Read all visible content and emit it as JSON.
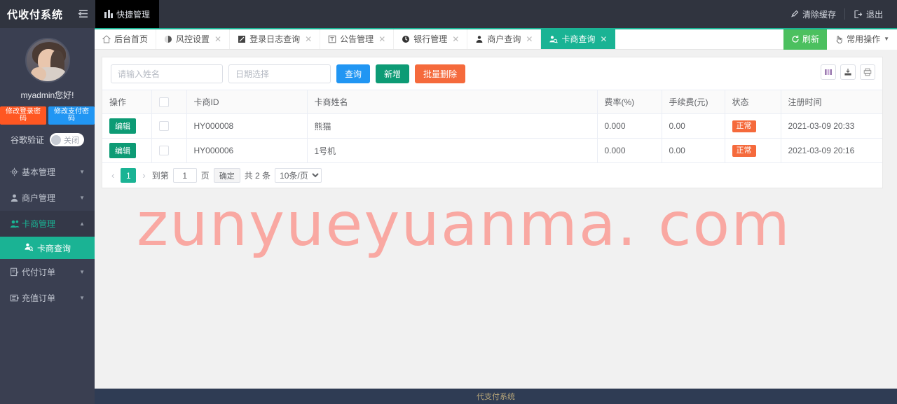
{
  "header": {
    "brand": "代收付系统",
    "collapse_icon": "collapse-menu-icon",
    "quick_tab": "快捷管理",
    "clear_cache": "清除缓存",
    "logout": "退出"
  },
  "sidebar": {
    "greeting": "myadmin您好!",
    "btn_change_login_pw": "修改登录密码",
    "btn_change_pay_pw": "修改支付密码",
    "ga_label": "谷歌验证",
    "ga_state": "关闭",
    "menu": [
      {
        "label": "基本管理",
        "icon": "gear-icon",
        "expanded": false
      },
      {
        "label": "商户管理",
        "icon": "user-icon",
        "expanded": false
      },
      {
        "label": "卡商管理",
        "icon": "users-icon",
        "expanded": true
      },
      {
        "label": "代付订单",
        "icon": "file-edit-icon",
        "expanded": false
      },
      {
        "label": "充值订单",
        "icon": "wallet-icon",
        "expanded": false
      }
    ],
    "submenu": {
      "label": "卡商查询",
      "icon": "user-search-icon",
      "active": true
    }
  },
  "tabbar": {
    "tabs": [
      {
        "label": "后台首页",
        "icon": "home-icon",
        "closable": false,
        "active": false
      },
      {
        "label": "风控设置",
        "icon": "shield-icon",
        "closable": true,
        "active": false
      },
      {
        "label": "登录日志查询",
        "icon": "log-icon",
        "closable": true,
        "active": false
      },
      {
        "label": "公告管理",
        "icon": "announce-icon",
        "closable": true,
        "active": false
      },
      {
        "label": "银行管理",
        "icon": "bank-icon",
        "closable": true,
        "active": false
      },
      {
        "label": "商户查询",
        "icon": "person-icon",
        "closable": true,
        "active": false
      },
      {
        "label": "卡商查询",
        "icon": "person-search-icon",
        "closable": true,
        "active": true
      }
    ],
    "refresh": "刷新",
    "common_ops": "常用操作"
  },
  "toolbar": {
    "name_placeholder": "请输入姓名",
    "name_value": "",
    "date_placeholder": "日期选择",
    "date_value": "",
    "btn_query": "查询",
    "btn_add": "新增",
    "btn_batch_delete": "批量删除",
    "icons": [
      "columns-icon",
      "export-icon",
      "print-icon"
    ]
  },
  "table": {
    "columns": [
      "操作",
      "",
      "卡商ID",
      "卡商姓名",
      "费率(%)",
      "手续费(元)",
      "状态",
      "注册时间"
    ],
    "edit_label": "编辑",
    "rows": [
      {
        "id": "HY000008",
        "name": "熊猫",
        "rate": "0.000",
        "fee": "0.00",
        "status": "正常",
        "time": "2021-03-09 20:33"
      },
      {
        "id": "HY000006",
        "name": "1号机",
        "rate": "0.000",
        "fee": "0.00",
        "status": "正常",
        "time": "2021-03-09 20:16"
      }
    ]
  },
  "pager": {
    "prev": "‹",
    "current": "1",
    "next": "›",
    "goto_label": "到第",
    "goto_value": "1",
    "page_unit": "页",
    "confirm": "确定",
    "total": "共 2 条",
    "page_size": "10条/页"
  },
  "watermark": "zunyueyuanma. com",
  "footer": {
    "text": "代支付系统"
  },
  "colors": {
    "teal": "#1ab394",
    "green": "#4cc05f",
    "blue": "#2196f3",
    "orange": "#f56a3c",
    "dark": "#3a3f51",
    "header": "#30343f",
    "footer": "#2f3c54",
    "watermark": "#f9a8a2"
  }
}
